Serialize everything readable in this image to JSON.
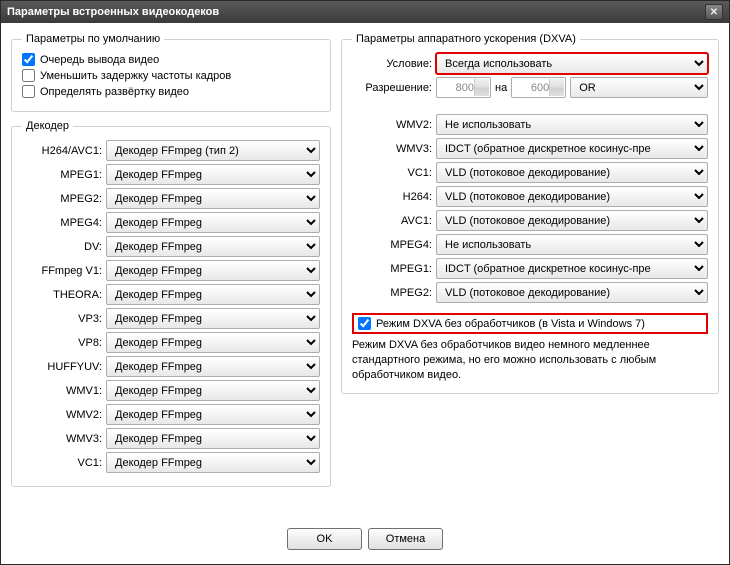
{
  "title": "Параметры встроенных видеокодеков",
  "defaults": {
    "legend": "Параметры по умолчанию",
    "queue_output": {
      "label": "Очередь вывода видео",
      "checked": true
    },
    "reduce_fps_delay": {
      "label": "Уменьшить задержку частоты кадров",
      "checked": false
    },
    "detect_scan": {
      "label": "Определять развёртку видео",
      "checked": false
    }
  },
  "decoder": {
    "legend": "Декодер",
    "rows": [
      {
        "label": "H264/AVC1:",
        "value": "Декодер FFmpeg (тип 2)"
      },
      {
        "label": "MPEG1:",
        "value": "Декодер FFmpeg"
      },
      {
        "label": "MPEG2:",
        "value": "Декодер FFmpeg"
      },
      {
        "label": "MPEG4:",
        "value": "Декодер FFmpeg"
      },
      {
        "label": "DV:",
        "value": "Декодер FFmpeg"
      },
      {
        "label": "FFmpeg V1:",
        "value": "Декодер FFmpeg"
      },
      {
        "label": "THEORA:",
        "value": "Декодер FFmpeg"
      },
      {
        "label": "VP3:",
        "value": "Декодер FFmpeg"
      },
      {
        "label": "VP8:",
        "value": "Декодер FFmpeg"
      },
      {
        "label": "HUFFYUV:",
        "value": "Декодер FFmpeg"
      },
      {
        "label": "WMV1:",
        "value": "Декодер FFmpeg"
      },
      {
        "label": "WMV2:",
        "value": "Декодер FFmpeg"
      },
      {
        "label": "WMV3:",
        "value": "Декодер FFmpeg"
      },
      {
        "label": "VC1:",
        "value": "Декодер FFmpeg"
      }
    ]
  },
  "dxva": {
    "legend": "Параметры аппаратного ускорения (DXVA)",
    "condition_label": "Условие:",
    "condition_value": "Всегда использовать",
    "resolution_label": "Разрешение:",
    "res_w": "800",
    "res_sep": "на",
    "res_h": "600",
    "res_or": "OR",
    "rows": [
      {
        "label": "WMV2:",
        "value": "Не использовать"
      },
      {
        "label": "WMV3:",
        "value": "IDCT (обратное дискретное косинус-пре"
      },
      {
        "label": "VC1:",
        "value": "VLD (потоковое декодирование)"
      },
      {
        "label": "H264:",
        "value": "VLD (потоковое декодирование)"
      },
      {
        "label": "AVC1:",
        "value": "VLD (потоковое декодирование)"
      },
      {
        "label": "MPEG4:",
        "value": "Не использовать"
      },
      {
        "label": "MPEG1:",
        "value": "IDCT (обратное дискретное косинус-пре"
      },
      {
        "label": "MPEG2:",
        "value": "VLD (потоковое декодирование)"
      }
    ],
    "noproc_label": "Режим DXVA без обработчиков (в Vista и Windows 7)",
    "noproc_checked": true,
    "noproc_desc": "Режим DXVA без обработчиков видео немного медленнее стандартного режима, но его можно использовать с любым обработчиком видео."
  },
  "buttons": {
    "ok": "OK",
    "cancel": "Отмена"
  }
}
